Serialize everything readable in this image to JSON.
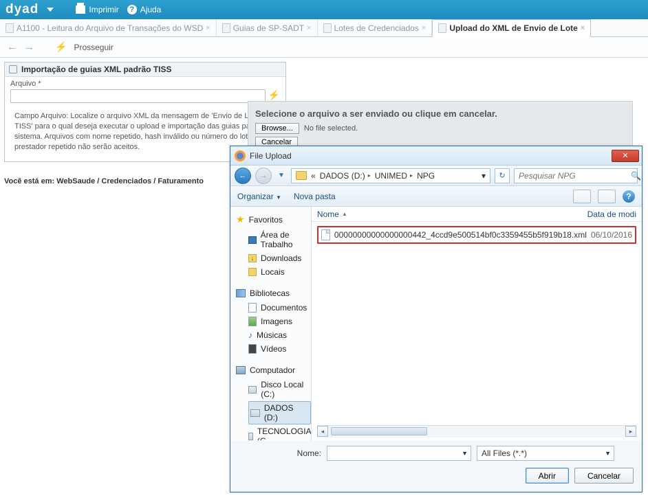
{
  "topbar": {
    "brand": "dyad",
    "print": "Imprimir",
    "help": "Ajuda"
  },
  "tabs": [
    {
      "label": "A1100 - Leitura do Arquivo de Transações do WSD",
      "active": false
    },
    {
      "label": "Guias de SP-SADT",
      "active": false
    },
    {
      "label": "Lotes de Credenciados",
      "active": false
    },
    {
      "label": "Upload do XML de Envio de Lote",
      "active": true
    }
  ],
  "toolbar": {
    "prosseguir": "Prosseguir"
  },
  "panel": {
    "title": "Importação de guias XML padrão TISS",
    "field_label": "Arquivo *",
    "hint": "Campo Arquivo: Localize o arquivo XML da mensagem de 'Envio de Lotes TISS' para o qual deseja executar o upload e importação das guias para o sistema. Arquivos com nome repetido, hash inválido ou número do lote do prestador repetido não serão aceitos."
  },
  "breadcrumb": "Você está em: WebSaude / Credenciados / Faturamento",
  "upload_pane": {
    "heading": "Selecione o arquivo a ser enviado ou clique em cancelar.",
    "browse": "Browse...",
    "no_file": "No file selected.",
    "cancelar": "Cancelar"
  },
  "dialog": {
    "title": "File Upload",
    "path": {
      "sep": "«",
      "p1": "DADOS (D:)",
      "p2": "UNIMED",
      "p3": "NPG"
    },
    "search_placeholder": "Pesquisar NPG",
    "organizar": "Organizar",
    "nova_pasta": "Nova pasta",
    "tree": {
      "favoritos": "Favoritos",
      "desktop": "Área de Trabalho",
      "downloads": "Downloads",
      "locais": "Locais",
      "bibliotecas": "Bibliotecas",
      "documentos": "Documentos",
      "imagens": "Imagens",
      "musicas": "Músicas",
      "videos": "Vídeos",
      "computador": "Computador",
      "disco_c": "Disco Local (C:)",
      "dados_d": "DADOS (D:)",
      "tecnologia": "TECNOLOGIA (G"
    },
    "columns": {
      "name": "Nome",
      "date": "Data de modi"
    },
    "files": [
      {
        "name": "00000000000000000442_4ccd9e500514bf0c3359455b5f919b18.xml",
        "date": "06/10/2016"
      }
    ],
    "footer": {
      "nome_label": "Nome:",
      "filter": "All Files (*.*)",
      "abrir": "Abrir",
      "cancelar": "Cancelar"
    }
  }
}
